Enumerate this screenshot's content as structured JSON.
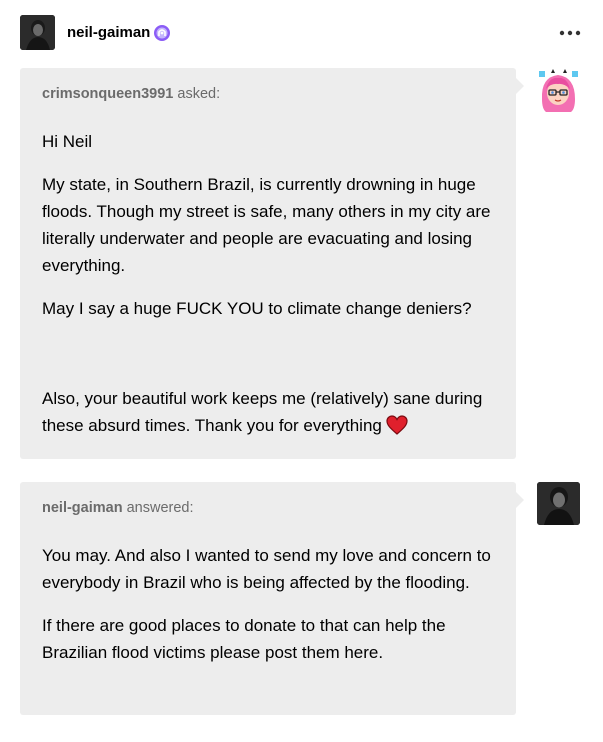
{
  "header": {
    "blog_name": "neil-gaiman",
    "avatar_icon": "author-portrait-avatar",
    "badge_icon": "purple-badge-icon",
    "more_icon": "ellipsis-icon"
  },
  "ask": {
    "username": "crimsonqueen3991",
    "verb": " asked:",
    "avatar_icon": "pink-hair-character-avatar",
    "paragraphs": [
      "Hi Neil",
      "My state, in Southern Brazil, is currently drowning in huge floods. Though my street is safe, many others in my city are literally underwater and people are evacuating and losing everything.",
      "May I say a huge FUCK YOU to climate change deniers?",
      "Also, your beautiful work keeps me (relatively) sane during these absurd times. Thank you for everything"
    ],
    "emoji": "red-heart-icon"
  },
  "answer": {
    "username": "neil-gaiman",
    "verb": " answered:",
    "avatar_icon": "author-portrait-avatar",
    "paragraphs": [
      "You may. And also I wanted to send my love and concern to everybody in Brazil who is being affected by the flooding.",
      "If there are good places to donate to that can help the Brazilian flood victims please post them here."
    ]
  },
  "colors": {
    "bubble_bg": "#ededed",
    "meta_text": "#6b6b6b",
    "badge": "#8b5cf6",
    "heart": "#e0202c"
  }
}
